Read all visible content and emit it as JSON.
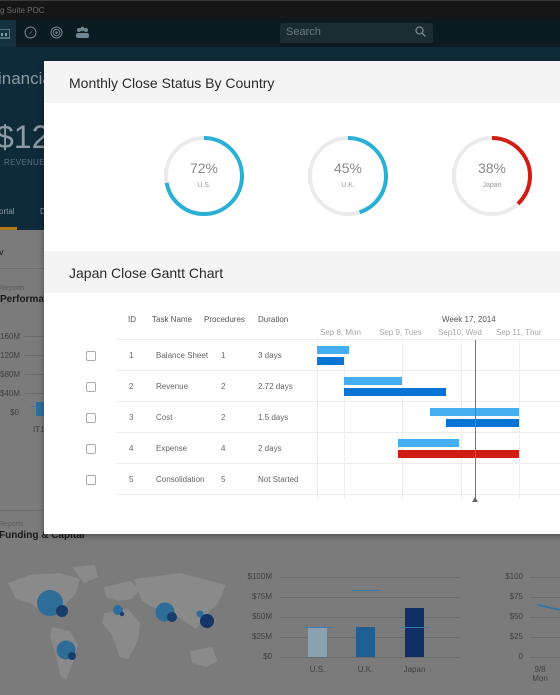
{
  "window": {
    "title": "g Suite POC"
  },
  "appbar": {
    "icons": [
      "home-card-icon",
      "compass-icon",
      "target-icon",
      "people-icon"
    ],
    "search_placeholder": "Search"
  },
  "hero": {
    "title": "inancia",
    "amount": "$12",
    "subtitle": "REVENUE",
    "tabs": [
      "ortal",
      "D"
    ]
  },
  "background": {
    "section1_label": "v",
    "perf_label": "Reports",
    "perf_title": "Performar",
    "perf_ticks": [
      "160M",
      "120M",
      "$80M",
      "$40M",
      "$0"
    ],
    "perf_xlabel": "IT1",
    "funding_label": "Reports",
    "funding_title": "Funding & Capital",
    "bar_ticks": [
      "$100M",
      "$75M",
      "$50M",
      "$25M",
      "$0"
    ],
    "bar_categories": [
      "U.S.",
      "U.K.",
      "Japan"
    ],
    "bar_values": [
      38,
      38,
      61
    ],
    "bar_targets": [
      38,
      84,
      38
    ],
    "line_ticks": [
      "$100",
      "$75",
      "$50",
      "$25",
      "0"
    ],
    "line_xlabel": [
      "9/8",
      "Mon"
    ]
  },
  "modal": {
    "status_title": "Monthly Close Status By Country",
    "donuts": [
      {
        "pct": "72%",
        "value": 72,
        "label": "U.S.",
        "color": "#2ab0d4"
      },
      {
        "pct": "45%",
        "value": 45,
        "label": "U.K.",
        "color": "#2ab0d4"
      },
      {
        "pct": "38%",
        "value": 38,
        "label": "Japan",
        "color": "#d01c12"
      }
    ],
    "gantt_title": "Japan Close Gantt Chart",
    "columns": [
      "ID",
      "Task Name",
      "Procedures",
      "Duration"
    ],
    "week": "Week 17, 2014",
    "days": [
      "Sep 8, Mon",
      "Sep 9, Tues",
      "Sep10, Wed",
      "Sep 11, Thur"
    ],
    "rows": [
      {
        "id": "1",
        "task": "Balance Sheet",
        "procedures": "1",
        "duration": "3 days"
      },
      {
        "id": "2",
        "task": "Revenue",
        "procedures": "2",
        "duration": "2.72 days"
      },
      {
        "id": "3",
        "task": "Cost",
        "procedures": "2",
        "duration": "1.5 days"
      },
      {
        "id": "4",
        "task": "Expense",
        "procedures": "4",
        "duration": "2 days"
      },
      {
        "id": "5",
        "task": "Consolidation",
        "procedures": "5",
        "duration": "Not Started"
      }
    ],
    "bars": [
      {
        "row": 0,
        "kind": "plan",
        "start": 0.0,
        "end": 0.4,
        "color": "#45aef0"
      },
      {
        "row": 0,
        "kind": "actual",
        "start": 0.0,
        "end": 0.33,
        "color": "#0a74d6"
      },
      {
        "row": 1,
        "kind": "plan",
        "start": 0.33,
        "end": 1.05,
        "color": "#45aef0"
      },
      {
        "row": 1,
        "kind": "actual",
        "start": 0.33,
        "end": 1.6,
        "color": "#0a74d6"
      },
      {
        "row": 2,
        "kind": "plan",
        "start": 1.4,
        "end": 2.5,
        "color": "#45aef0"
      },
      {
        "row": 2,
        "kind": "actual",
        "start": 1.6,
        "end": 2.5,
        "color": "#0a74d6"
      },
      {
        "row": 3,
        "kind": "plan",
        "start": 1.0,
        "end": 1.76,
        "color": "#45aef0"
      },
      {
        "row": 3,
        "kind": "actual",
        "start": 1.0,
        "end": 2.5,
        "color": "#d01c12"
      }
    ],
    "today": 1.96
  }
}
